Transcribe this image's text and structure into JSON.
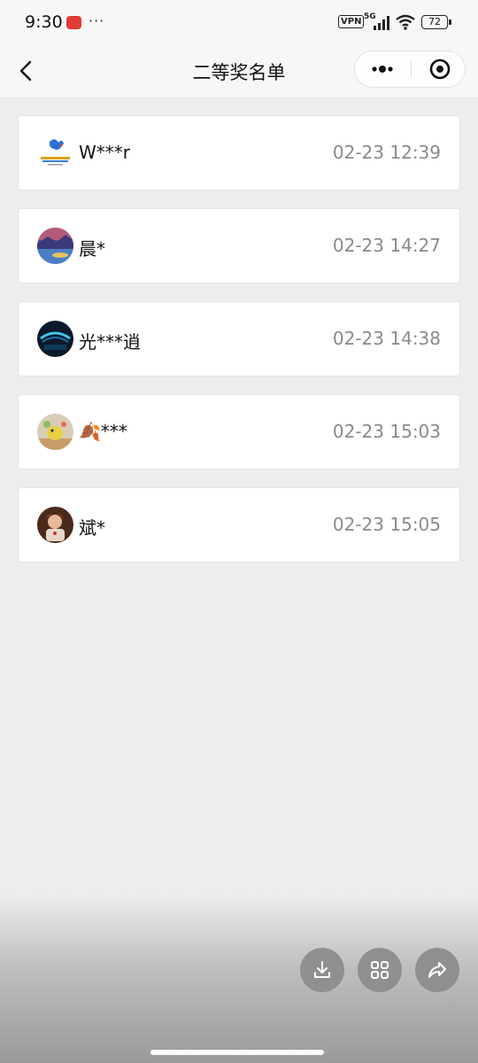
{
  "status_bar": {
    "time": "9:30",
    "more_indicator": "···",
    "vpn": "VPN",
    "network": "5G",
    "battery": "72"
  },
  "nav": {
    "title": "二等奖名单",
    "back_icon": "chevron-left-icon",
    "more_icon": "more-dots-icon",
    "close_icon": "target-close-icon"
  },
  "winners": [
    {
      "name": "W***r",
      "time": "02-23 12:39"
    },
    {
      "name": "晨*",
      "time": "02-23 14:27"
    },
    {
      "name": "光***逍",
      "time": "02-23 14:38"
    },
    {
      "name": "🍂***",
      "time": "02-23 15:03"
    },
    {
      "name": "斌*",
      "time": "02-23 15:05"
    }
  ],
  "actions": [
    {
      "icon": "download-icon"
    },
    {
      "icon": "grid-icon"
    },
    {
      "icon": "share-icon"
    }
  ],
  "colors": {
    "background": "#ededed",
    "card": "#ffffff",
    "timestamp": "#8a8a8a",
    "fab": "#8f8f8f"
  }
}
